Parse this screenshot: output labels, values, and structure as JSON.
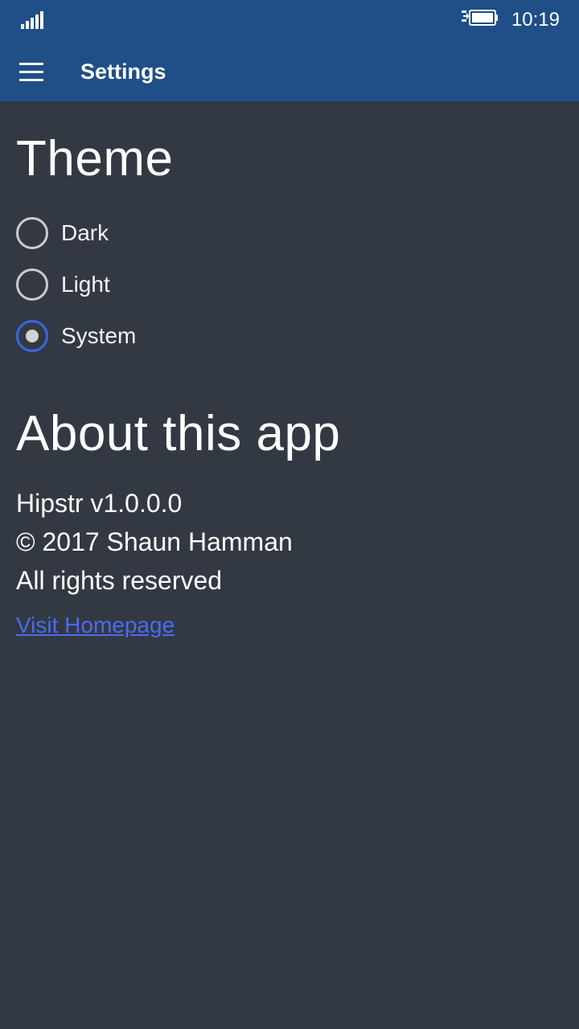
{
  "status_bar": {
    "time": "10:19",
    "signal_icon": "signal-bars-icon",
    "battery_icon": "battery-charging-icon"
  },
  "app_bar": {
    "menu_icon": "hamburger-menu-icon",
    "title": "Settings",
    "background": "#1f4f86"
  },
  "theme": {
    "title": "Theme",
    "options": [
      {
        "label": "Dark",
        "selected": false
      },
      {
        "label": "Light",
        "selected": false
      },
      {
        "label": "System",
        "selected": true
      }
    ],
    "accent": "#3d63e8"
  },
  "about": {
    "title": "About this app",
    "version": "Hipstr v1.0.0.0",
    "copyright": "© 2017 Shaun Hamman",
    "rights": "All rights reserved",
    "link_label": "Visit Homepage",
    "link_color": "#4a6bf0"
  },
  "colors": {
    "page_background": "#333942"
  }
}
